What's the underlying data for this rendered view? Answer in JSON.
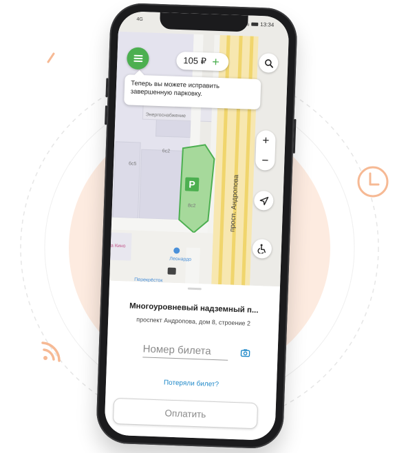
{
  "status_bar": {
    "carrier": "4G",
    "battery_percent": "%",
    "time": "13:34"
  },
  "header": {
    "balance": "105 ₽",
    "add_label": "+"
  },
  "tooltip": {
    "text": "Теперь вы можете исправить завершенную парковку."
  },
  "map": {
    "labels": {
      "energo": "Энергоснабжение",
      "b6c2": "6с2",
      "b6c5": "6с5",
      "b8c2": "8с2",
      "cinema": "а Кино",
      "leonardo": "Леонардо",
      "store": "Перекрёсток"
    },
    "street": "просп. Андропова",
    "parking_marker": "P",
    "zoom_in": "+",
    "zoom_out": "−",
    "parking_color": "#4caf50"
  },
  "sheet": {
    "place_name": "Многоуровневый надземный п...",
    "address": "проспект Андропова, дом 8, строение 2",
    "ticket_placeholder": "Номер билета",
    "lost_ticket": "Потеряли билет?",
    "pay_button": "Оплатить"
  },
  "colors": {
    "brand_green": "#4caf50",
    "link_blue": "#1e88c8",
    "accent_orange": "#f4a47a"
  }
}
